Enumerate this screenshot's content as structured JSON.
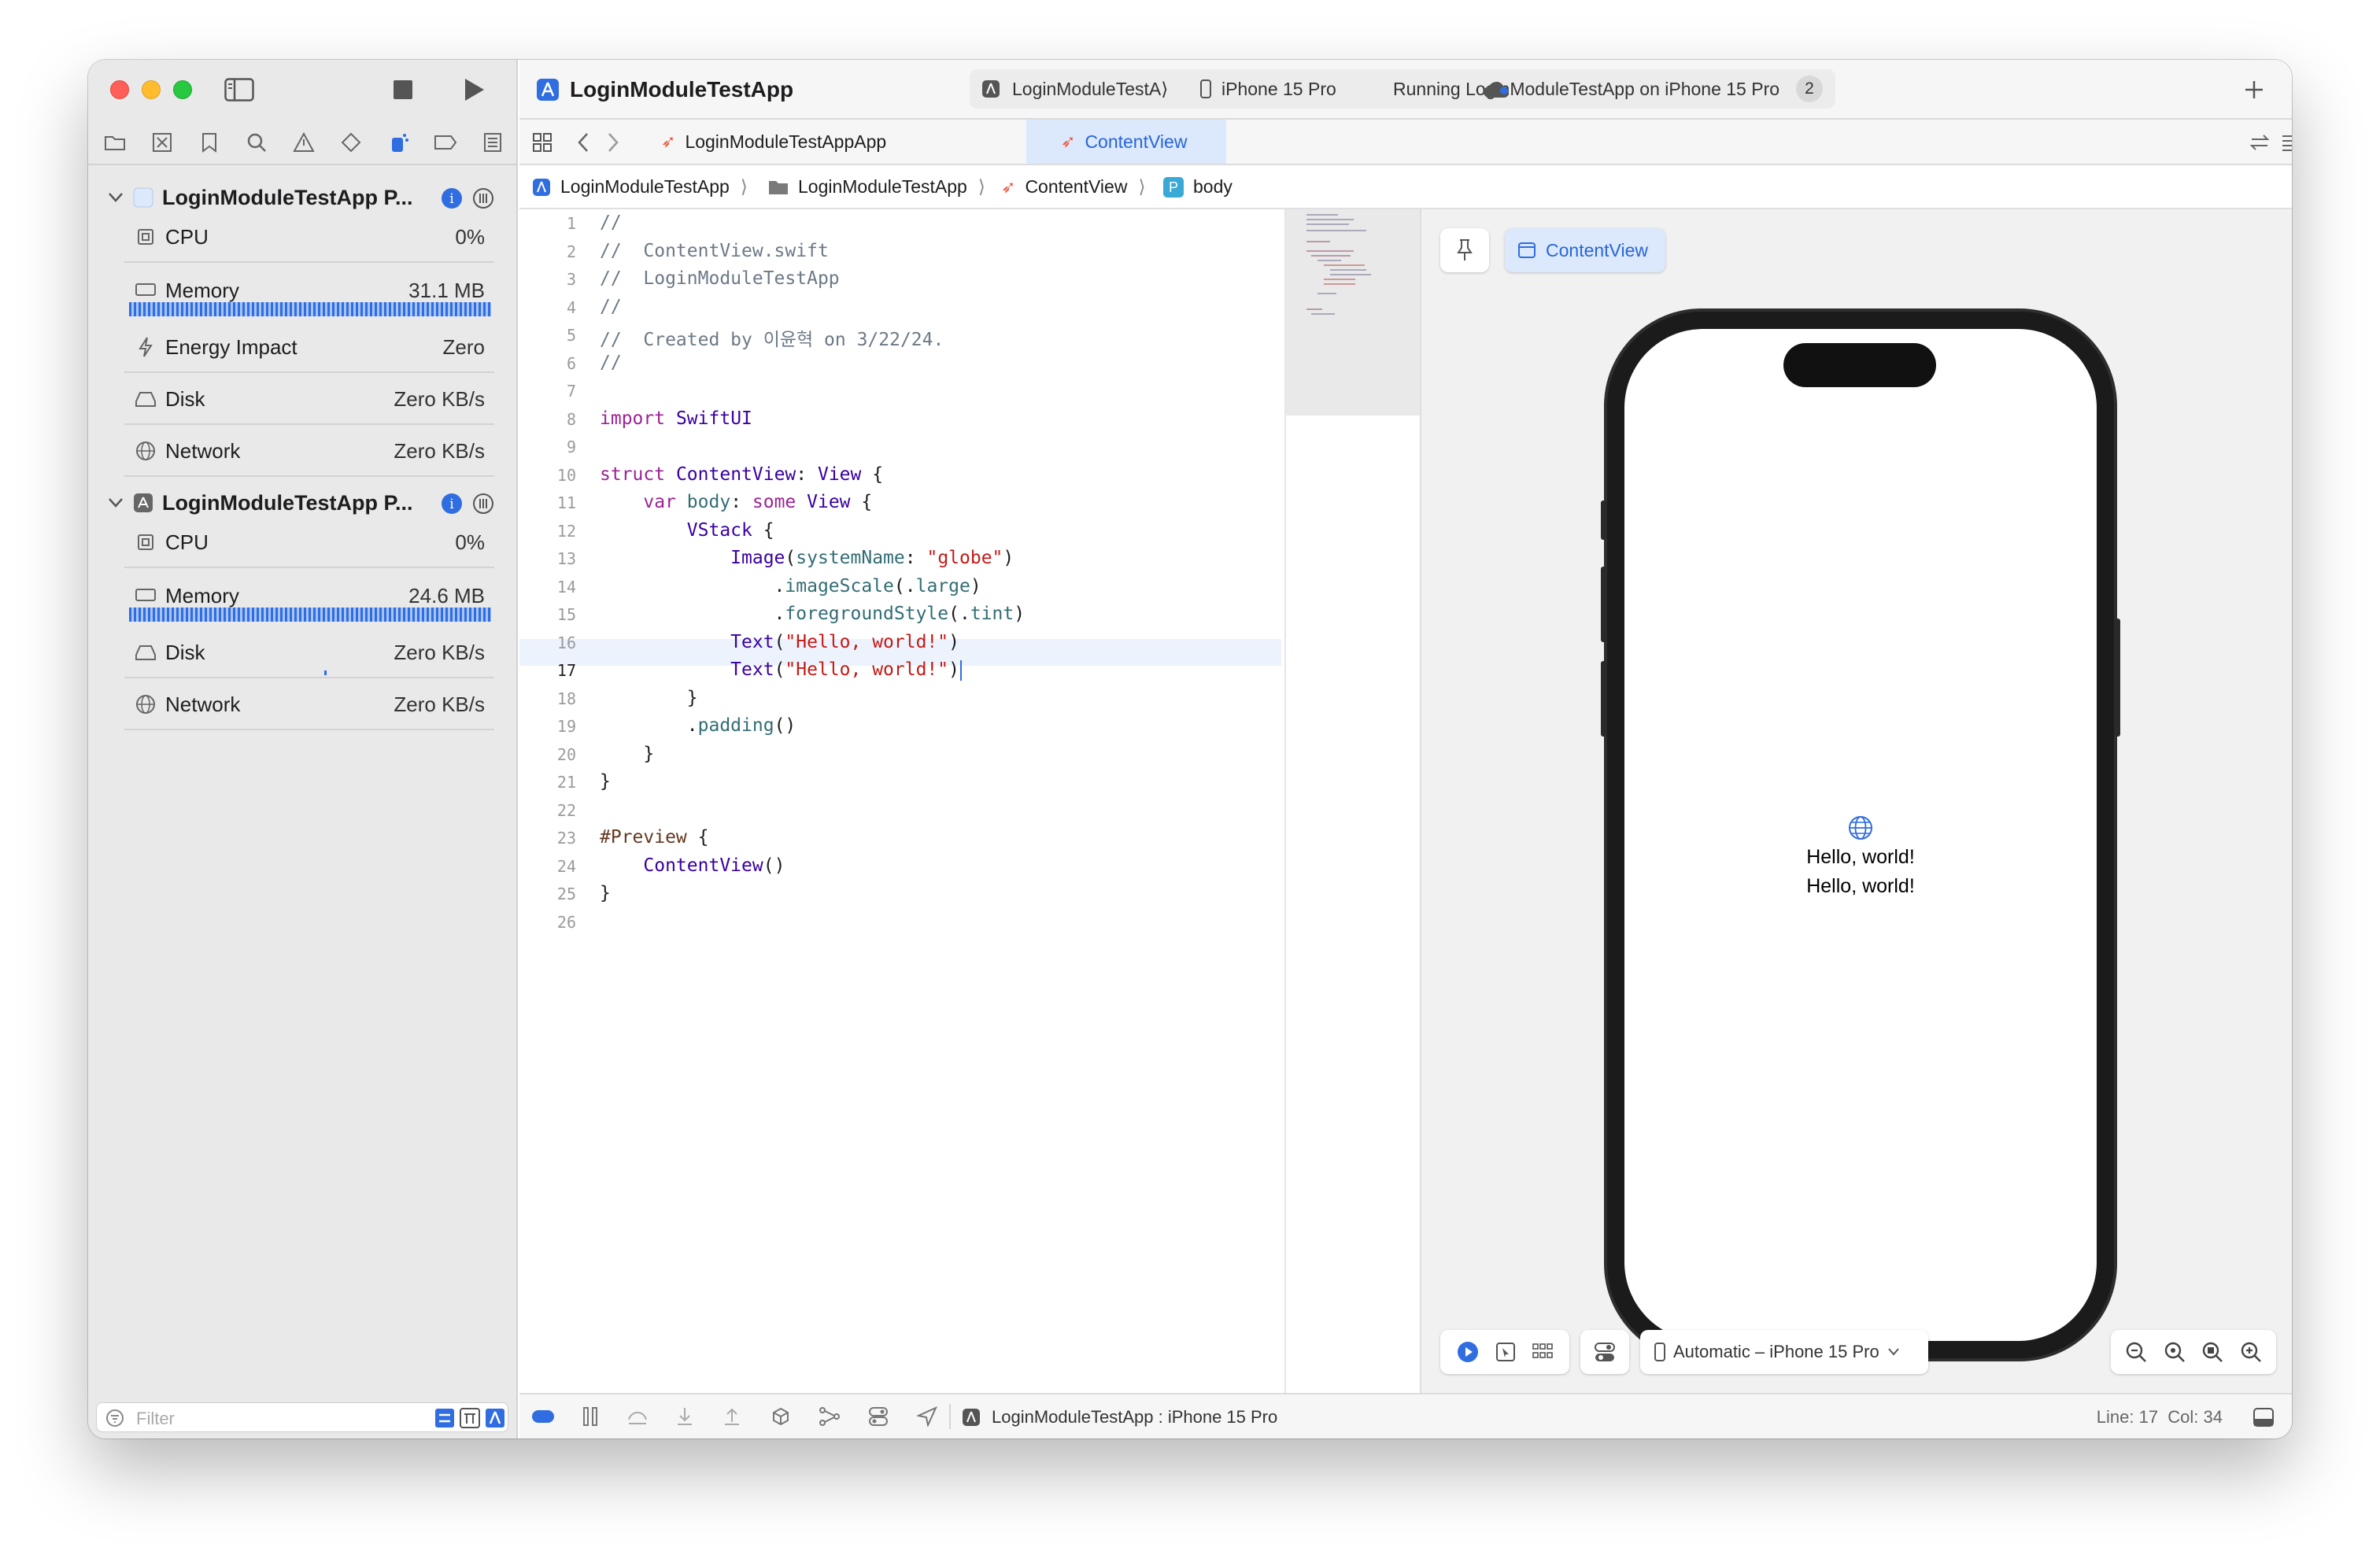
{
  "toolbar": {
    "project_title": "LoginModuleTestApp",
    "scheme_name": "LoginModuleTestA⟩",
    "device_name": "iPhone 15 Pro",
    "status_text": "Running LoginModuleTestApp on iPhone 15 Pro",
    "status_badge": "2"
  },
  "sidebar": {
    "processes": [
      {
        "name": "LoginModuleTestApp P...",
        "gauges": [
          {
            "label": "CPU",
            "value": "0%"
          },
          {
            "label": "Memory",
            "value": "31.1 MB"
          },
          {
            "label": "Energy Impact",
            "value": "Zero"
          },
          {
            "label": "Disk",
            "value": "Zero KB/s"
          },
          {
            "label": "Network",
            "value": "Zero KB/s"
          }
        ]
      },
      {
        "name": "LoginModuleTestApp P...",
        "gauges": [
          {
            "label": "CPU",
            "value": "0%"
          },
          {
            "label": "Memory",
            "value": "24.6 MB"
          },
          {
            "label": "Disk",
            "value": "Zero KB/s"
          },
          {
            "label": "Network",
            "value": "Zero KB/s"
          }
        ]
      }
    ],
    "filter_placeholder": "Filter"
  },
  "tabs": [
    {
      "label": "LoginModuleTestAppApp",
      "active": false
    },
    {
      "label": "ContentView",
      "active": true
    }
  ],
  "breadcrumb": [
    "LoginModuleTestApp",
    "LoginModuleTestApp",
    "ContentView",
    "body"
  ],
  "breadcrumb_body_badge": "P",
  "editor": {
    "current_line": 17,
    "lines": [
      "//",
      "//  ContentView.swift",
      "//  LoginModuleTestApp",
      "//",
      "//  Created by 이윤혁 on 3/22/24.",
      "//",
      "",
      "import SwiftUI",
      "",
      "struct ContentView: View {",
      "    var body: some View {",
      "        VStack {",
      "            Image(systemName: \"globe\")",
      "                .imageScale(.large)",
      "                .foregroundStyle(.tint)",
      "            Text(\"Hello, world!\")",
      "            Text(\"Hello, world!\")",
      "        }",
      "        .padding()",
      "    }",
      "}",
      "",
      "#Preview {",
      "    ContentView()",
      "}",
      ""
    ]
  },
  "preview": {
    "selector_label": "ContentView",
    "device_text_1": "Hello, world!",
    "device_text_2": "Hello, world!",
    "device_menu": "Automatic – iPhone 15 Pro"
  },
  "status": {
    "target": "LoginModuleTestApp : iPhone 15 Pro",
    "position": "Line: 17  Col: 34"
  },
  "colors": {
    "accent": "#2f6de0",
    "active_tab_bg": "#dce8fb",
    "swift_orange": "#f05138"
  }
}
